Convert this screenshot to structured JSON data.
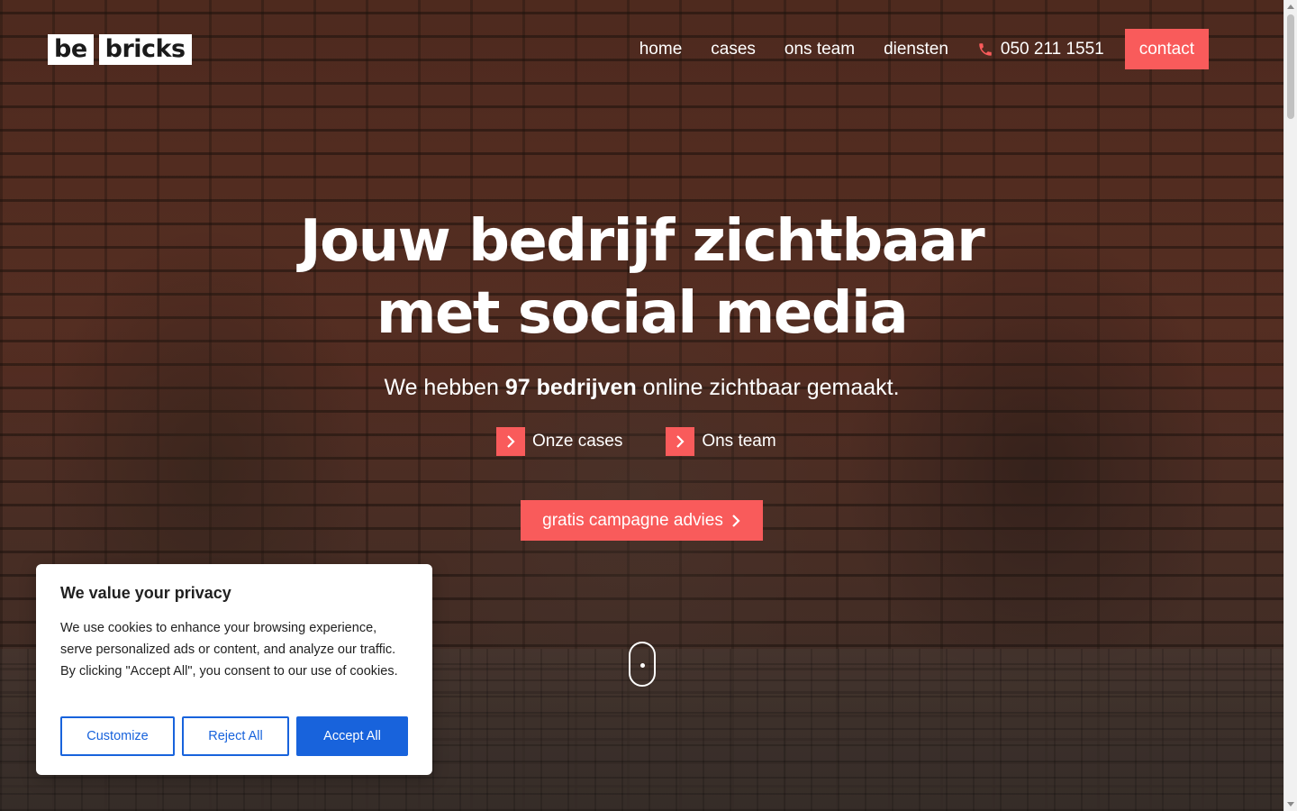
{
  "logo": {
    "part1": "be",
    "part2": "bricks"
  },
  "nav": {
    "items": [
      {
        "label": "home"
      },
      {
        "label": "cases"
      },
      {
        "label": "ons team"
      },
      {
        "label": "diensten"
      }
    ],
    "phone": "050 211 1551",
    "contact": "contact"
  },
  "hero": {
    "headline_line1": "Jouw bedrijf zichtbaar",
    "headline_line2_prefix": "met ",
    "headline_highlight": "social media",
    "subtitle_prefix": "We hebben ",
    "subtitle_bold": "97 bedrijven",
    "subtitle_suffix": " online zichtbaar gemaakt.",
    "link_cases": "Onze cases",
    "link_team": "Ons team",
    "cta": "gratis campagne advies"
  },
  "cookie": {
    "title": "We value your privacy",
    "body": "We use cookies to enhance your browsing experience, serve personalized ads or content, and analyze our traffic. By clicking \"Accept All\", you consent to our use of cookies.",
    "customize": "Customize",
    "reject": "Reject All",
    "accept": "Accept All"
  },
  "colors": {
    "accent": "#f95b5b",
    "cookie_blue": "#1863dc"
  },
  "icons": {
    "phone": "phone-icon",
    "chevron": "chevron-right-icon",
    "scroll": "scroll-mouse-icon"
  }
}
